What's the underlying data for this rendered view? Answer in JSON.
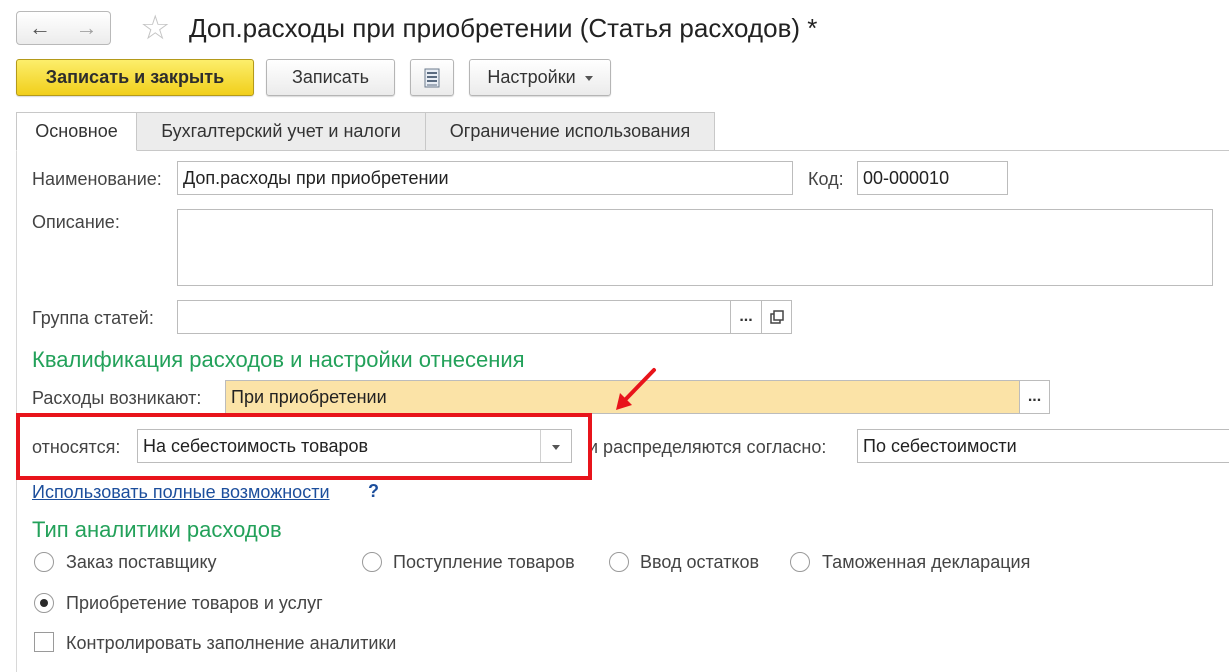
{
  "window": {
    "title": "Доп.расходы при приобретении (Статья расходов) *",
    "nav_back_glyph": "←",
    "nav_forward_glyph": "→",
    "star_glyph": "☆"
  },
  "toolbar": {
    "save_close_label": "Записать и закрыть",
    "save_label": "Записать",
    "list_icon": "list-icon",
    "settings_label": "Настройки"
  },
  "tabs": [
    {
      "label": "Основное",
      "active": true
    },
    {
      "label": "Бухгалтерский учет и налоги",
      "active": false
    },
    {
      "label": "Ограничение использования",
      "active": false
    }
  ],
  "form": {
    "name_label": "Наименование:",
    "name_value": "Доп.расходы при приобретении",
    "code_label": "Код:",
    "code_value": "00-000010",
    "description_label": "Описание:",
    "description_value": "",
    "group_label": "Группа статей:",
    "group_value": "",
    "ellipsis": "...",
    "open_icon": "open-icon"
  },
  "qualification": {
    "heading": "Квалификация расходов и настройки отнесения",
    "arise_label": "Расходы возникают:",
    "arise_value": "При приобретении",
    "relate_label": "относятся:",
    "relate_value": "На себестоимость товаров",
    "distribute_label": "и распределяются согласно:",
    "distribute_value": "По себестоимости",
    "full_link": "Использовать полные возможности",
    "help": "?"
  },
  "analytics": {
    "heading": "Тип аналитики расходов",
    "options": [
      {
        "label": "Заказ поставщику",
        "checked": false
      },
      {
        "label": "Поступление товаров",
        "checked": false
      },
      {
        "label": "Ввод остатков",
        "checked": false
      },
      {
        "label": "Таможенная декларация",
        "checked": false
      },
      {
        "label": "Приобретение товаров и услуг",
        "checked": true
      }
    ],
    "control_label": "Контролировать заполнение аналитики",
    "control_checked": false
  },
  "colors": {
    "highlight": "#e8141b",
    "arrow": "#e8141b",
    "section_heading": "#23a15a",
    "primary_button": "#f6dc3a",
    "yellow_field": "#fbe3a7"
  }
}
